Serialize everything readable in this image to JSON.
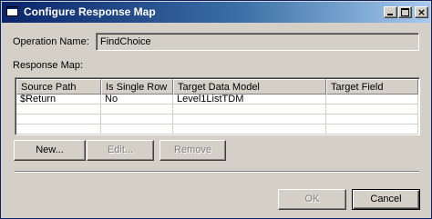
{
  "window": {
    "title": "Configure Response Map"
  },
  "operation": {
    "label": "Operation Name:",
    "value": "FindChoice"
  },
  "response_map": {
    "label": "Response Map:",
    "columns": [
      "Source Path",
      "Is Single Row",
      "Target Data Model",
      "Target Field"
    ],
    "rows": [
      [
        "$Return",
        "No",
        "Level1ListTDM",
        ""
      ]
    ]
  },
  "buttons": {
    "new": "New...",
    "edit": "Edit...",
    "remove": "Remove",
    "ok": "OK",
    "cancel": "Cancel"
  }
}
